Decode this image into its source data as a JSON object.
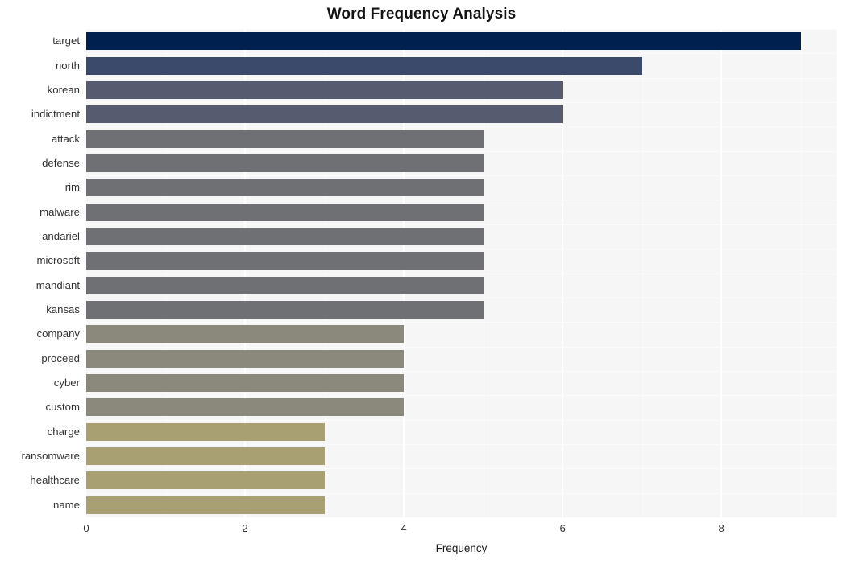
{
  "chart_data": {
    "type": "bar",
    "orientation": "horizontal",
    "title": "Word Frequency Analysis",
    "xlabel": "Frequency",
    "ylabel": "",
    "xlim": [
      0,
      9.45
    ],
    "ylim_categories": 20,
    "grid": true,
    "legend": "none",
    "xticks": [
      0,
      2,
      4,
      6,
      8
    ],
    "xtick_labels": [
      "0",
      "2",
      "4",
      "6",
      "8"
    ],
    "categories": [
      "target",
      "north",
      "korean",
      "indictment",
      "attack",
      "defense",
      "rim",
      "malware",
      "andariel",
      "microsoft",
      "mandiant",
      "kansas",
      "company",
      "proceed",
      "cyber",
      "custom",
      "charge",
      "ransomware",
      "healthcare",
      "name"
    ],
    "values": [
      9,
      7,
      6,
      6,
      5,
      5,
      5,
      5,
      5,
      5,
      5,
      5,
      4,
      4,
      4,
      4,
      3,
      3,
      3,
      3
    ],
    "bar_colors": [
      "#002050",
      "#3b4a6b",
      "#565b70",
      "#565b70",
      "#6e7073",
      "#6e7073",
      "#6e7073",
      "#6e7073",
      "#6e7073",
      "#6e7073",
      "#6e7073",
      "#6e7073",
      "#8b897b",
      "#8b897b",
      "#8b897b",
      "#8b897b",
      "#a89f73",
      "#a89f73",
      "#a89f73",
      "#a89f73"
    ],
    "colors": {
      "plot_background": "#f6f6f6",
      "figure_background": "#ffffff",
      "gridline": "#ffffff",
      "tick_label": "#333333",
      "title": "#141414"
    }
  }
}
